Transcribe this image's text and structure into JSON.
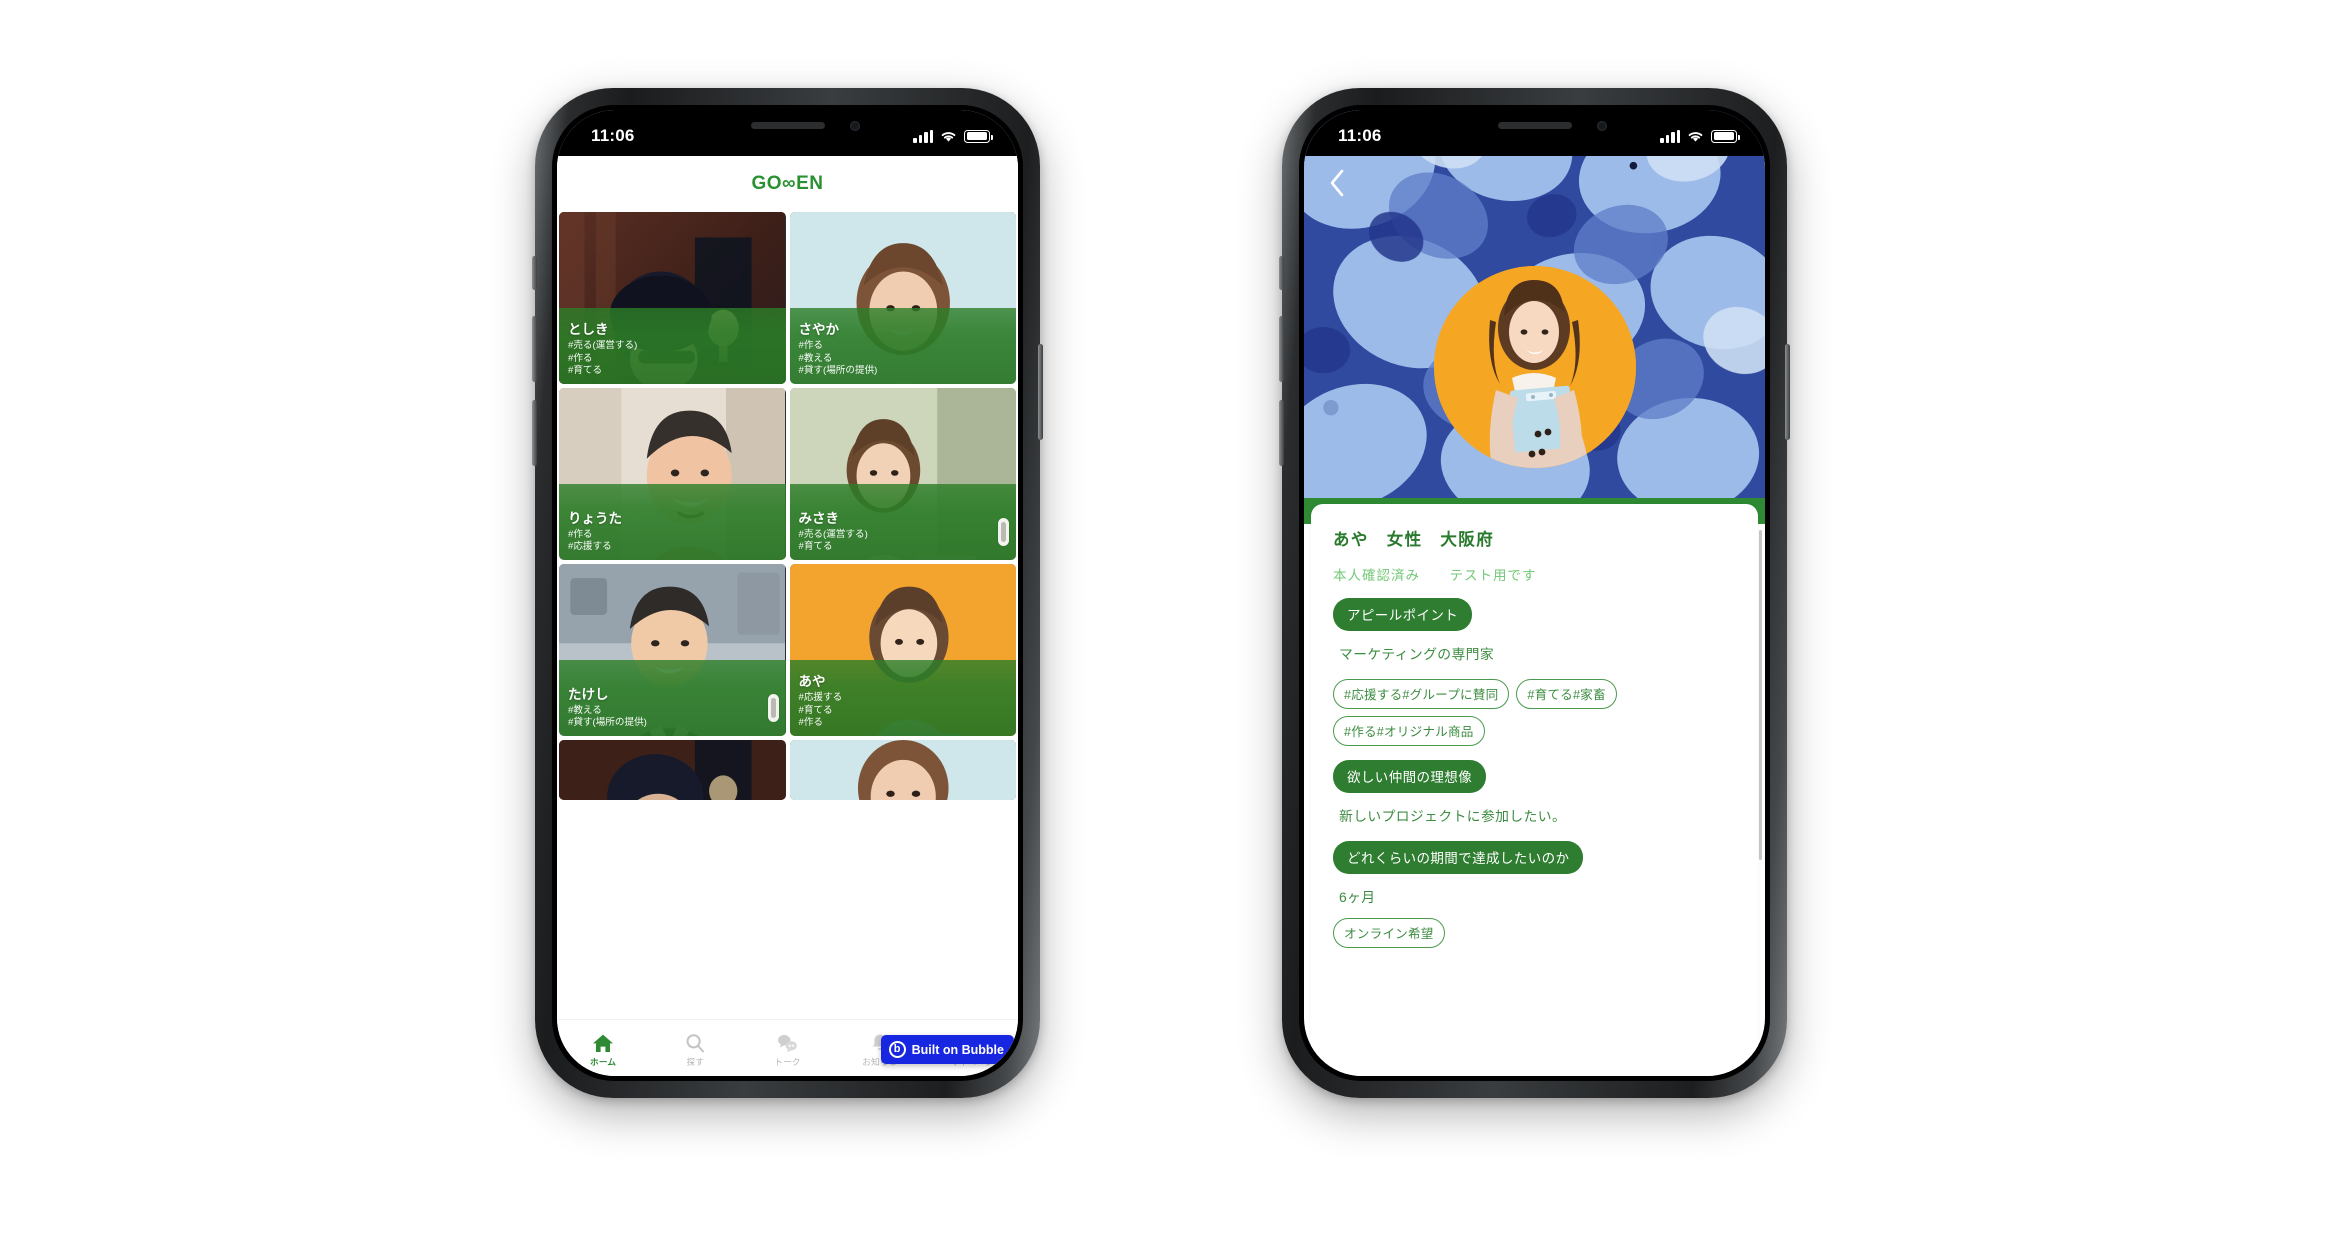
{
  "status_bar": {
    "time": "11:06",
    "signal_icon": "cellular-bars-icon",
    "wifi_icon": "wifi-icon",
    "battery_icon": "battery-icon"
  },
  "colors": {
    "brand_green": "#2a9132",
    "card_green": "#2c7e28",
    "tab_active": "#2e8b33",
    "tab_inactive": "#b6b6b6",
    "chip_border": "#4a9a4d",
    "pill_solid": "#2e7d30",
    "subtitle_green": "#73c977",
    "bubble_blue": "#1726e0",
    "avatar_orange": "#f5a623"
  },
  "left_phone": {
    "header": {
      "brand": "GO∞EN"
    },
    "cards": [
      {
        "name": "としき",
        "tags": [
          "#売る(運営する)",
          "#作る",
          "#育てる"
        ],
        "photo": "man-at-desk-photo",
        "has_scroll_pill": false
      },
      {
        "name": "さやか",
        "tags": [
          "#作る",
          "#教える",
          "#貸す(場所の提供)"
        ],
        "photo": "smiling-woman-photo",
        "has_scroll_pill": false
      },
      {
        "name": "りょうた",
        "tags": [
          "#作る",
          "#応援する"
        ],
        "photo": "smiling-man-cafe-photo",
        "has_scroll_pill": false
      },
      {
        "name": "みさき",
        "tags": [
          "#売る(運営する)",
          "#育てる"
        ],
        "photo": "woman-outdoors-photo",
        "has_scroll_pill": true
      },
      {
        "name": "たけし",
        "tags": [
          "#教える",
          "#貸す(場所の提供)"
        ],
        "photo": "man-in-suit-photo",
        "has_scroll_pill": true
      },
      {
        "name": "あや",
        "tags": [
          "#応援する",
          "#育てる",
          "#作る"
        ],
        "photo": "woman-orange-bg-photo",
        "has_scroll_pill": false
      }
    ],
    "partial_cards": [
      {
        "photo": "man-at-desk-photo"
      },
      {
        "photo": "smiling-woman-photo"
      }
    ],
    "tabbar": [
      {
        "label": "ホーム",
        "icon": "home-icon",
        "active": true
      },
      {
        "label": "探す",
        "icon": "search-icon",
        "active": false
      },
      {
        "label": "トーク",
        "icon": "chat-bubbles-icon",
        "active": false
      },
      {
        "label": "お知らせ",
        "icon": "bell-icon",
        "active": false
      },
      {
        "label": "マイページ",
        "icon": "person-icon",
        "active": false
      }
    ],
    "bubble_badge": {
      "label": "Built on Bubble",
      "mark": "b"
    }
  },
  "right_phone": {
    "back_button": {
      "icon": "chevron-left-icon"
    },
    "cover_photo": "blue-hydrangea-photo",
    "avatar_photo": "woman-with-clipboard-photo",
    "profile": {
      "title": "あや　女性　大阪府",
      "verified_label": "本人確認済み",
      "note_label": "テスト用です",
      "sections": [
        {
          "heading": "アピールポイント",
          "body": "マーケティングの専門家"
        },
        {
          "heading": "欲しい仲間の理想像",
          "body": "新しいプロジェクトに参加したい。"
        },
        {
          "heading": "どれくらいの期間で達成したいのか",
          "body": "6ヶ月"
        }
      ],
      "tags": [
        "#応援する#グループに賛同",
        "#育てる#家畜",
        "#作る#オリジナル商品"
      ],
      "cut_tag": "オンライン希望"
    }
  }
}
